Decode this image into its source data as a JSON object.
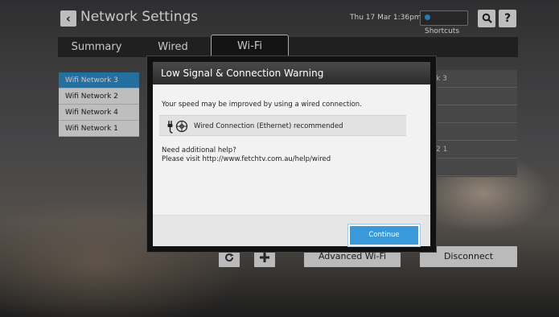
{
  "header": {
    "title": "Network Settings",
    "datetime": "Thu 17 Mar 1:36pm",
    "shortcuts_label": "Shortcuts",
    "search_glyph": "Q",
    "help_glyph": "?"
  },
  "tabs": [
    {
      "label": "Summary"
    },
    {
      "label": "Wired"
    },
    {
      "label": "Wi-Fi"
    }
  ],
  "networks": [
    {
      "label": "Wifi Network 3"
    },
    {
      "label": "Wifi Network 2"
    },
    {
      "label": "Wifi Network 4"
    },
    {
      "label": "Wifi Network 1"
    }
  ],
  "right_panel": [
    "k 3",
    "",
    "",
    "",
    "2 1",
    "",
    ""
  ],
  "bottom": {
    "advanced_label": "Advanced Wi-Fi",
    "disconnect_label": "Disconnect"
  },
  "modal": {
    "title": "Low Signal & Connection Warning",
    "message": "Your speed may be improved by using a wired connection.",
    "recommendation": "Wired Connection (Ethernet) recommended",
    "help_line1": "Need additional help?",
    "help_line2": "Please visit http://www.fetchtv.com.au/help/wired",
    "continue_label": "Continue"
  },
  "colors": {
    "accent": "#3a9ad9",
    "selected_item": "#2f8fca"
  }
}
